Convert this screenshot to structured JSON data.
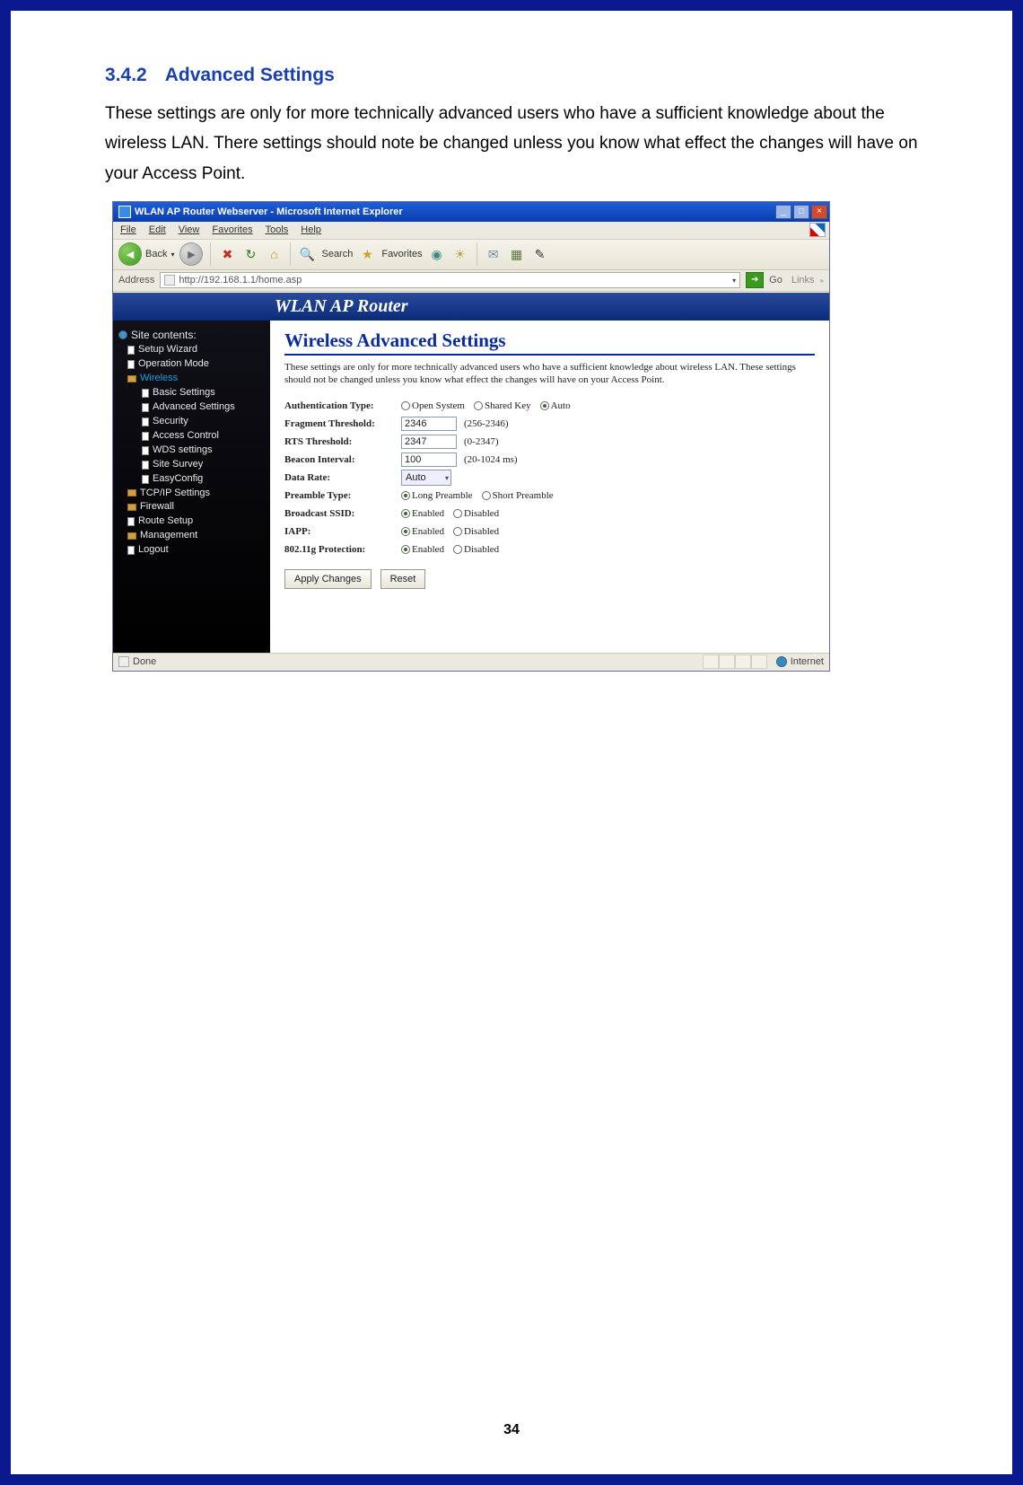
{
  "doc": {
    "section_number": "3.4.2",
    "section_title": "Advanced Settings",
    "body": "These settings are only for more technically advanced users who have a sufficient knowledge about the wireless LAN. There settings should note be changed unless you know what effect the changes will have on your Access Point.",
    "page_number": "34"
  },
  "ie": {
    "title": "WLAN AP Router Webserver - Microsoft Internet Explorer",
    "menus": {
      "file": "File",
      "edit": "Edit",
      "view": "View",
      "favorites": "Favorites",
      "tools": "Tools",
      "help": "Help"
    },
    "toolbar": {
      "back": "Back",
      "search": "Search",
      "favorites": "Favorites"
    },
    "addr_label": "Address",
    "url": "http://192.168.1.1/home.asp",
    "go": "Go",
    "links": "Links",
    "status_left": "Done",
    "status_zone": "Internet"
  },
  "router": {
    "header": "WLAN AP Router",
    "nav": {
      "root": "Site contents:",
      "setup_wizard": "Setup Wizard",
      "operation_mode": "Operation Mode",
      "wireless": "Wireless",
      "basic_settings": "Basic Settings",
      "advanced_settings": "Advanced Settings",
      "security": "Security",
      "access_control": "Access Control",
      "wds_settings": "WDS settings",
      "site_survey": "Site Survey",
      "easyconfig": "EasyConfig",
      "tcpip": "TCP/IP Settings",
      "firewall": "Firewall",
      "route_setup": "Route Setup",
      "management": "Management",
      "logout": "Logout"
    },
    "main": {
      "title": "Wireless Advanced Settings",
      "desc": "These settings are only for more technically advanced users who have a sufficient knowledge about wireless LAN. These settings should not be changed unless you know what effect the changes will have on your Access Point.",
      "labels": {
        "auth": "Authentication Type:",
        "frag": "Fragment Threshold:",
        "rts": "RTS Threshold:",
        "beacon": "Beacon Interval:",
        "rate": "Data Rate:",
        "preamble": "Preamble Type:",
        "bssid": "Broadcast SSID:",
        "iapp": "IAPP:",
        "prot": "802.11g Protection:"
      },
      "values": {
        "frag": "2346",
        "rts": "2347",
        "beacon": "100",
        "rate": "Auto"
      },
      "ranges": {
        "frag": "(256-2346)",
        "rts": "(0-2347)",
        "beacon": "(20-1024 ms)"
      },
      "radios": {
        "open": "Open System",
        "shared": "Shared Key",
        "auto": "Auto",
        "long": "Long Preamble",
        "short": "Short Preamble",
        "enabled": "Enabled",
        "disabled": "Disabled"
      },
      "buttons": {
        "apply": "Apply Changes",
        "reset": "Reset"
      }
    }
  }
}
